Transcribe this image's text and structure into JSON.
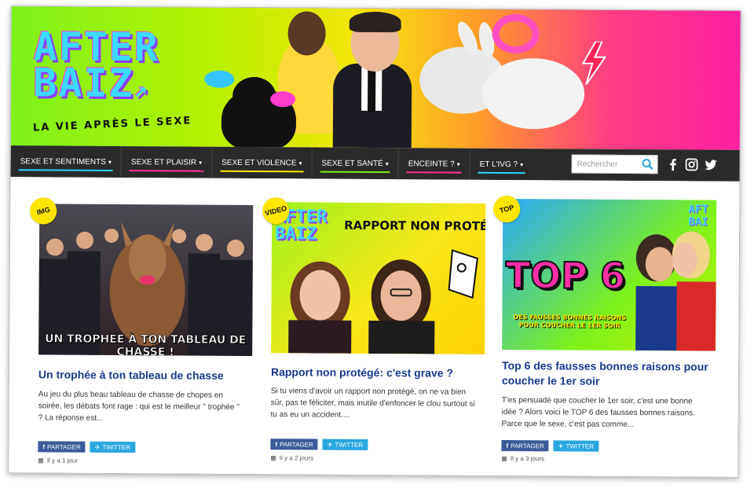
{
  "banner": {
    "logo_line1": "AFTER",
    "logo_line2": "BAIZ",
    "tagline": "LA VIE APRÈS LE SEXE"
  },
  "nav": {
    "items": [
      {
        "label": "SEXE ET SENTIMENTS",
        "color": "#2fd5ff"
      },
      {
        "label": "SEXE ET PLAISIR",
        "color": "#ff2f9a"
      },
      {
        "label": "SEXE ET VIOLENCE",
        "color": "#ffe600"
      },
      {
        "label": "SEXE ET SANTÉ",
        "color": "#7cf21a"
      },
      {
        "label": "ENCEINTE ?",
        "color": "#ff2f9a"
      },
      {
        "label": "ET L'IVG ?",
        "color": "#2fd5ff"
      }
    ],
    "search_placeholder": "Rechercher",
    "social": [
      "facebook-icon",
      "instagram-icon",
      "twitter-icon"
    ]
  },
  "cards": [
    {
      "badge": "IMG",
      "thumb_caption": "UN TROPHÉE À TON TABLEAU DE CHASSE !",
      "title": "Un trophée à ton tableau de chasse",
      "text": "Au jeu du plus beau tableau de chasse de chopes en soirée, les débats font rage : qui est le meilleur \" trophée \" ? La réponse est...",
      "share_fb": "PARTAGER",
      "share_tw": "TWITTER",
      "date": "Il y a 1 jour"
    },
    {
      "badge": "VIDEO",
      "thumb_logo": "AFTER BAIZ",
      "thumb_caption": "RAPPORT NON PROTÉG",
      "title": "Rapport non protégé: c'est grave ?",
      "text": "Si tu viens d'avoir un rapport non protégé, on ne va bien sûr, pas te féliciter, mais inutile d'enfoncer le clou surtout si tu as eu un accident....",
      "share_fb": "PARTAGER",
      "share_tw": "TWITTER",
      "date": "Il y a 2 jours"
    },
    {
      "badge": "TOP",
      "thumb_logo": "AFT BAI",
      "thumb_caption": "TOP 6",
      "thumb_sub": "DES FAUSSES BONNES RAISONS POUR COUCHER LE 1ER SOIR",
      "title": "Top 6 des fausses bonnes raisons pour coucher le 1er soir",
      "text": "T'es persuadé que coucher le 1er soir, c'est une bonne idée ? Alors voici le TOP 6 des fausses bonnes raisons. Parce que le sexe, c'est pas comme...",
      "share_fb": "PARTAGER",
      "share_tw": "TWITTER",
      "date": "Il y a 3 jours"
    }
  ]
}
